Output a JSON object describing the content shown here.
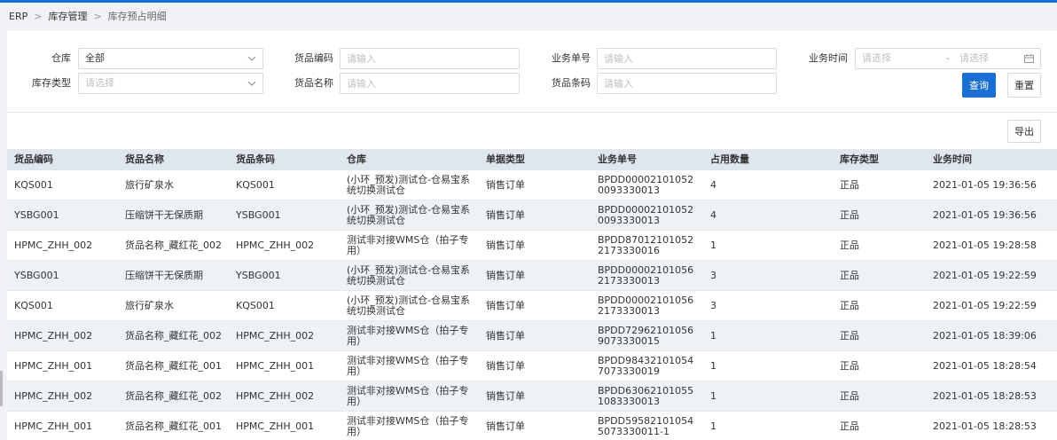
{
  "breadcrumb": [
    "ERP",
    "库存管理",
    "库存预占明细"
  ],
  "filters": {
    "warehouse": {
      "label": "仓库",
      "value": "全部"
    },
    "stock_type": {
      "label": "库存类型",
      "placeholder": "请选择"
    },
    "goods_code": {
      "label": "货品编码",
      "placeholder": "请输入"
    },
    "goods_name": {
      "label": "货品名称",
      "placeholder": "请输入"
    },
    "business_no": {
      "label": "业务单号",
      "placeholder": "请输入"
    },
    "barcode": {
      "label": "货品条码",
      "placeholder": "请输入"
    },
    "business_time": {
      "label": "业务时间",
      "start_placeholder": "请选择",
      "separator": "-",
      "end_placeholder": "请选择"
    }
  },
  "buttons": {
    "query": "查询",
    "reset": "重置",
    "export": "导出"
  },
  "table": {
    "columns": [
      "货品编码",
      "货品名称",
      "货品条码",
      "仓库",
      "单据类型",
      "业务单号",
      "占用数量",
      "库存类型",
      "业务时间"
    ],
    "rows": [
      [
        "KQS001",
        "旅行矿泉水",
        "KQS001",
        "(小环_预发)测试仓-仓易宝系统切换测试仓",
        "销售订单",
        "BPDD000021010520093330013",
        "4",
        "正品",
        "2021-01-05 19:36:56"
      ],
      [
        "YSBG001",
        "压缩饼干无保质期",
        "YSBG001",
        "(小环_预发)测试仓-仓易宝系统切换测试仓",
        "销售订单",
        "BPDD000021010520093330013",
        "4",
        "正品",
        "2021-01-05 19:36:56"
      ],
      [
        "HPMC_ZHH_002",
        "货品名称_藏红花_002",
        "HPMC_ZHH_002",
        "测试非对接WMS仓（拍子专用）",
        "销售订单",
        "BPDD870121010522173330016",
        "1",
        "正品",
        "2021-01-05 19:28:58"
      ],
      [
        "YSBG001",
        "压缩饼干无保质期",
        "YSBG001",
        "(小环_预发)测试仓-仓易宝系统切换测试仓",
        "销售订单",
        "BPDD000021010562173330013",
        "3",
        "正品",
        "2021-01-05 19:22:59"
      ],
      [
        "KQS001",
        "旅行矿泉水",
        "KQS001",
        "(小环_预发)测试仓-仓易宝系统切换测试仓",
        "销售订单",
        "BPDD000021010562173330013",
        "3",
        "正品",
        "2021-01-05 19:22:59"
      ],
      [
        "HPMC_ZHH_002",
        "货品名称_藏红花_002",
        "HPMC_ZHH_002",
        "测试非对接WMS仓（拍子专用）",
        "销售订单",
        "BPDD729621010569073330015",
        "1",
        "正品",
        "2021-01-05 18:39:06"
      ],
      [
        "HPMC_ZHH_001",
        "货品名称_藏红花_001",
        "HPMC_ZHH_001",
        "测试非对接WMS仓（拍子专用）",
        "销售订单",
        "BPDD984321010547073330019",
        "1",
        "正品",
        "2021-01-05 18:28:54"
      ],
      [
        "HPMC_ZHH_002",
        "货品名称_藏红花_002",
        "HPMC_ZHH_002",
        "测试非对接WMS仓（拍子专用）",
        "销售订单",
        "BPDD630621010551083330013",
        "1",
        "正品",
        "2021-01-05 18:28:53"
      ],
      [
        "HPMC_ZHH_001",
        "货品名称_藏红花_001",
        "HPMC_ZHH_001",
        "测试非对接WMS仓（拍子专用）",
        "销售订单",
        "BPDD595821010545073330011-1",
        "1",
        "正品",
        "2021-01-05 18:28:53"
      ]
    ]
  },
  "colors": {
    "primary": "#1a6fd4",
    "header_bg": "#dfe6ee",
    "alt_row": "#eef2f7"
  }
}
